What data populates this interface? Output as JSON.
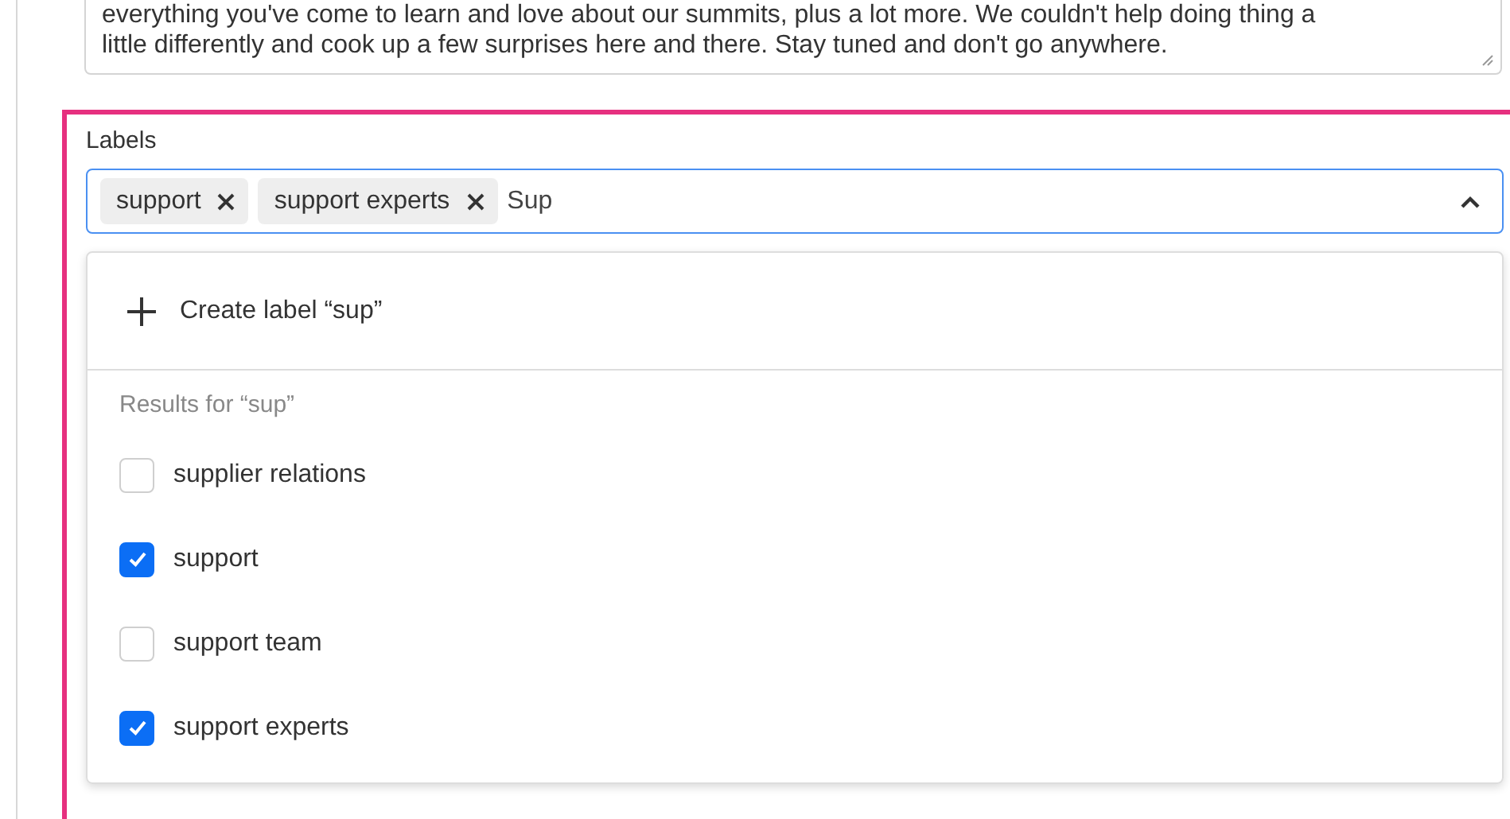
{
  "description": {
    "lines": [
      "everything you've come to learn and love about our summits, plus a lot more. We couldn't help doing thing a",
      "little differently and cook up a few surprises here and there. Stay tuned and don't go anywhere."
    ]
  },
  "labels_field": {
    "label": "Labels",
    "chips": [
      {
        "label": "support"
      },
      {
        "label": "support experts"
      }
    ],
    "value": "Sup",
    "expanded": true
  },
  "dropdown": {
    "create_option": "Create label “sup”",
    "results_heading": "Results for “sup”",
    "results": [
      {
        "label": "supplier relations",
        "checked": false
      },
      {
        "label": "support",
        "checked": true
      },
      {
        "label": "support team",
        "checked": false
      },
      {
        "label": "support experts",
        "checked": true
      }
    ]
  }
}
